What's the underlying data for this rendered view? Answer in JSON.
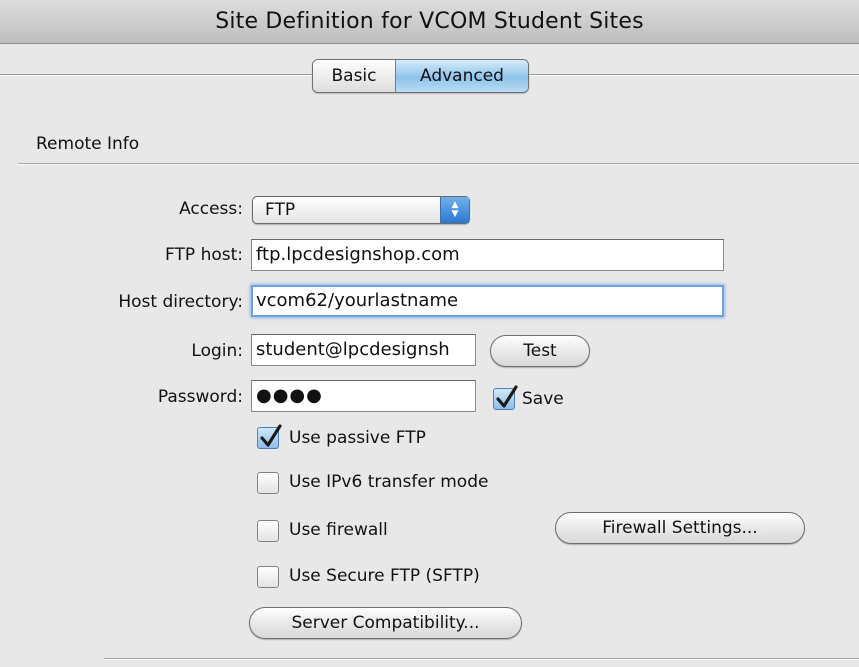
{
  "window": {
    "title": "Site Definition for  VCOM Student Sites"
  },
  "tabs": [
    {
      "label": "Basic",
      "selected": false
    },
    {
      "label": "Advanced",
      "selected": true
    }
  ],
  "section": {
    "title": "Remote Info"
  },
  "form": {
    "access_label": "Access:",
    "access_value": "FTP",
    "ftp_host_label": "FTP host:",
    "ftp_host_value": "ftp.lpcdesignshop.com",
    "host_dir_label": "Host directory:",
    "host_dir_value": "vcom62/yourlastname",
    "login_label": "Login:",
    "login_value": "student@lpcdesignsh",
    "password_label": "Password:",
    "password_value": "●●●●",
    "test_button": "Test",
    "save_label": "Save",
    "save_checked": true
  },
  "options": {
    "passive_label": "Use passive FTP",
    "passive_checked": true,
    "ipv6_label": "Use IPv6 transfer mode",
    "ipv6_checked": false,
    "firewall_label": "Use firewall",
    "firewall_checked": false,
    "sftp_label": "Use Secure FTP (SFTP)",
    "sftp_checked": false,
    "firewall_settings_button": "Firewall Settings...",
    "server_compat_button": "Server Compatibility..."
  },
  "colors": {
    "accent": "#8fc3ea",
    "focus": "#6da2de",
    "window_bg": "#e8e8e8"
  },
  "icons": {
    "checkmark": "checkmark-icon",
    "select_arrows": "up-down-arrows-icon"
  }
}
